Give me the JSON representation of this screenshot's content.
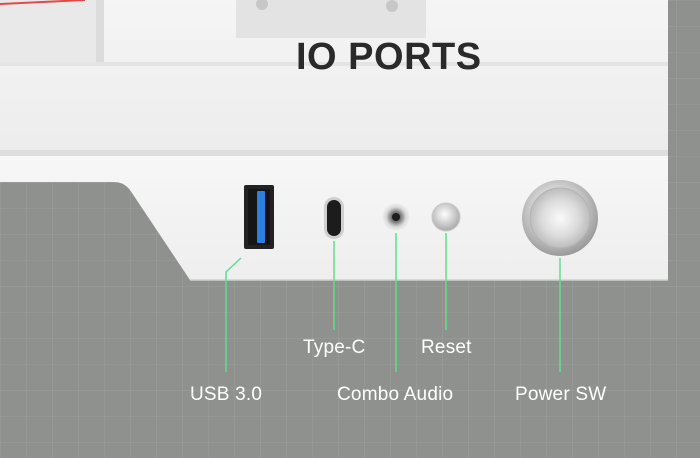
{
  "title": "IO PORTS",
  "ports": {
    "usb": {
      "label": "USB 3.0"
    },
    "typec": {
      "label": "Type-C"
    },
    "audio": {
      "label": "Combo Audio"
    },
    "reset": {
      "label": "Reset"
    },
    "power": {
      "label": "Power SW"
    }
  },
  "colors": {
    "background": "#8f918f",
    "panel": "#f3f3f3",
    "callout_line": "#5fe08a",
    "usb_accent": "#2f7de0",
    "label_text": "#ffffff",
    "title_text": "#2a2a2a"
  }
}
